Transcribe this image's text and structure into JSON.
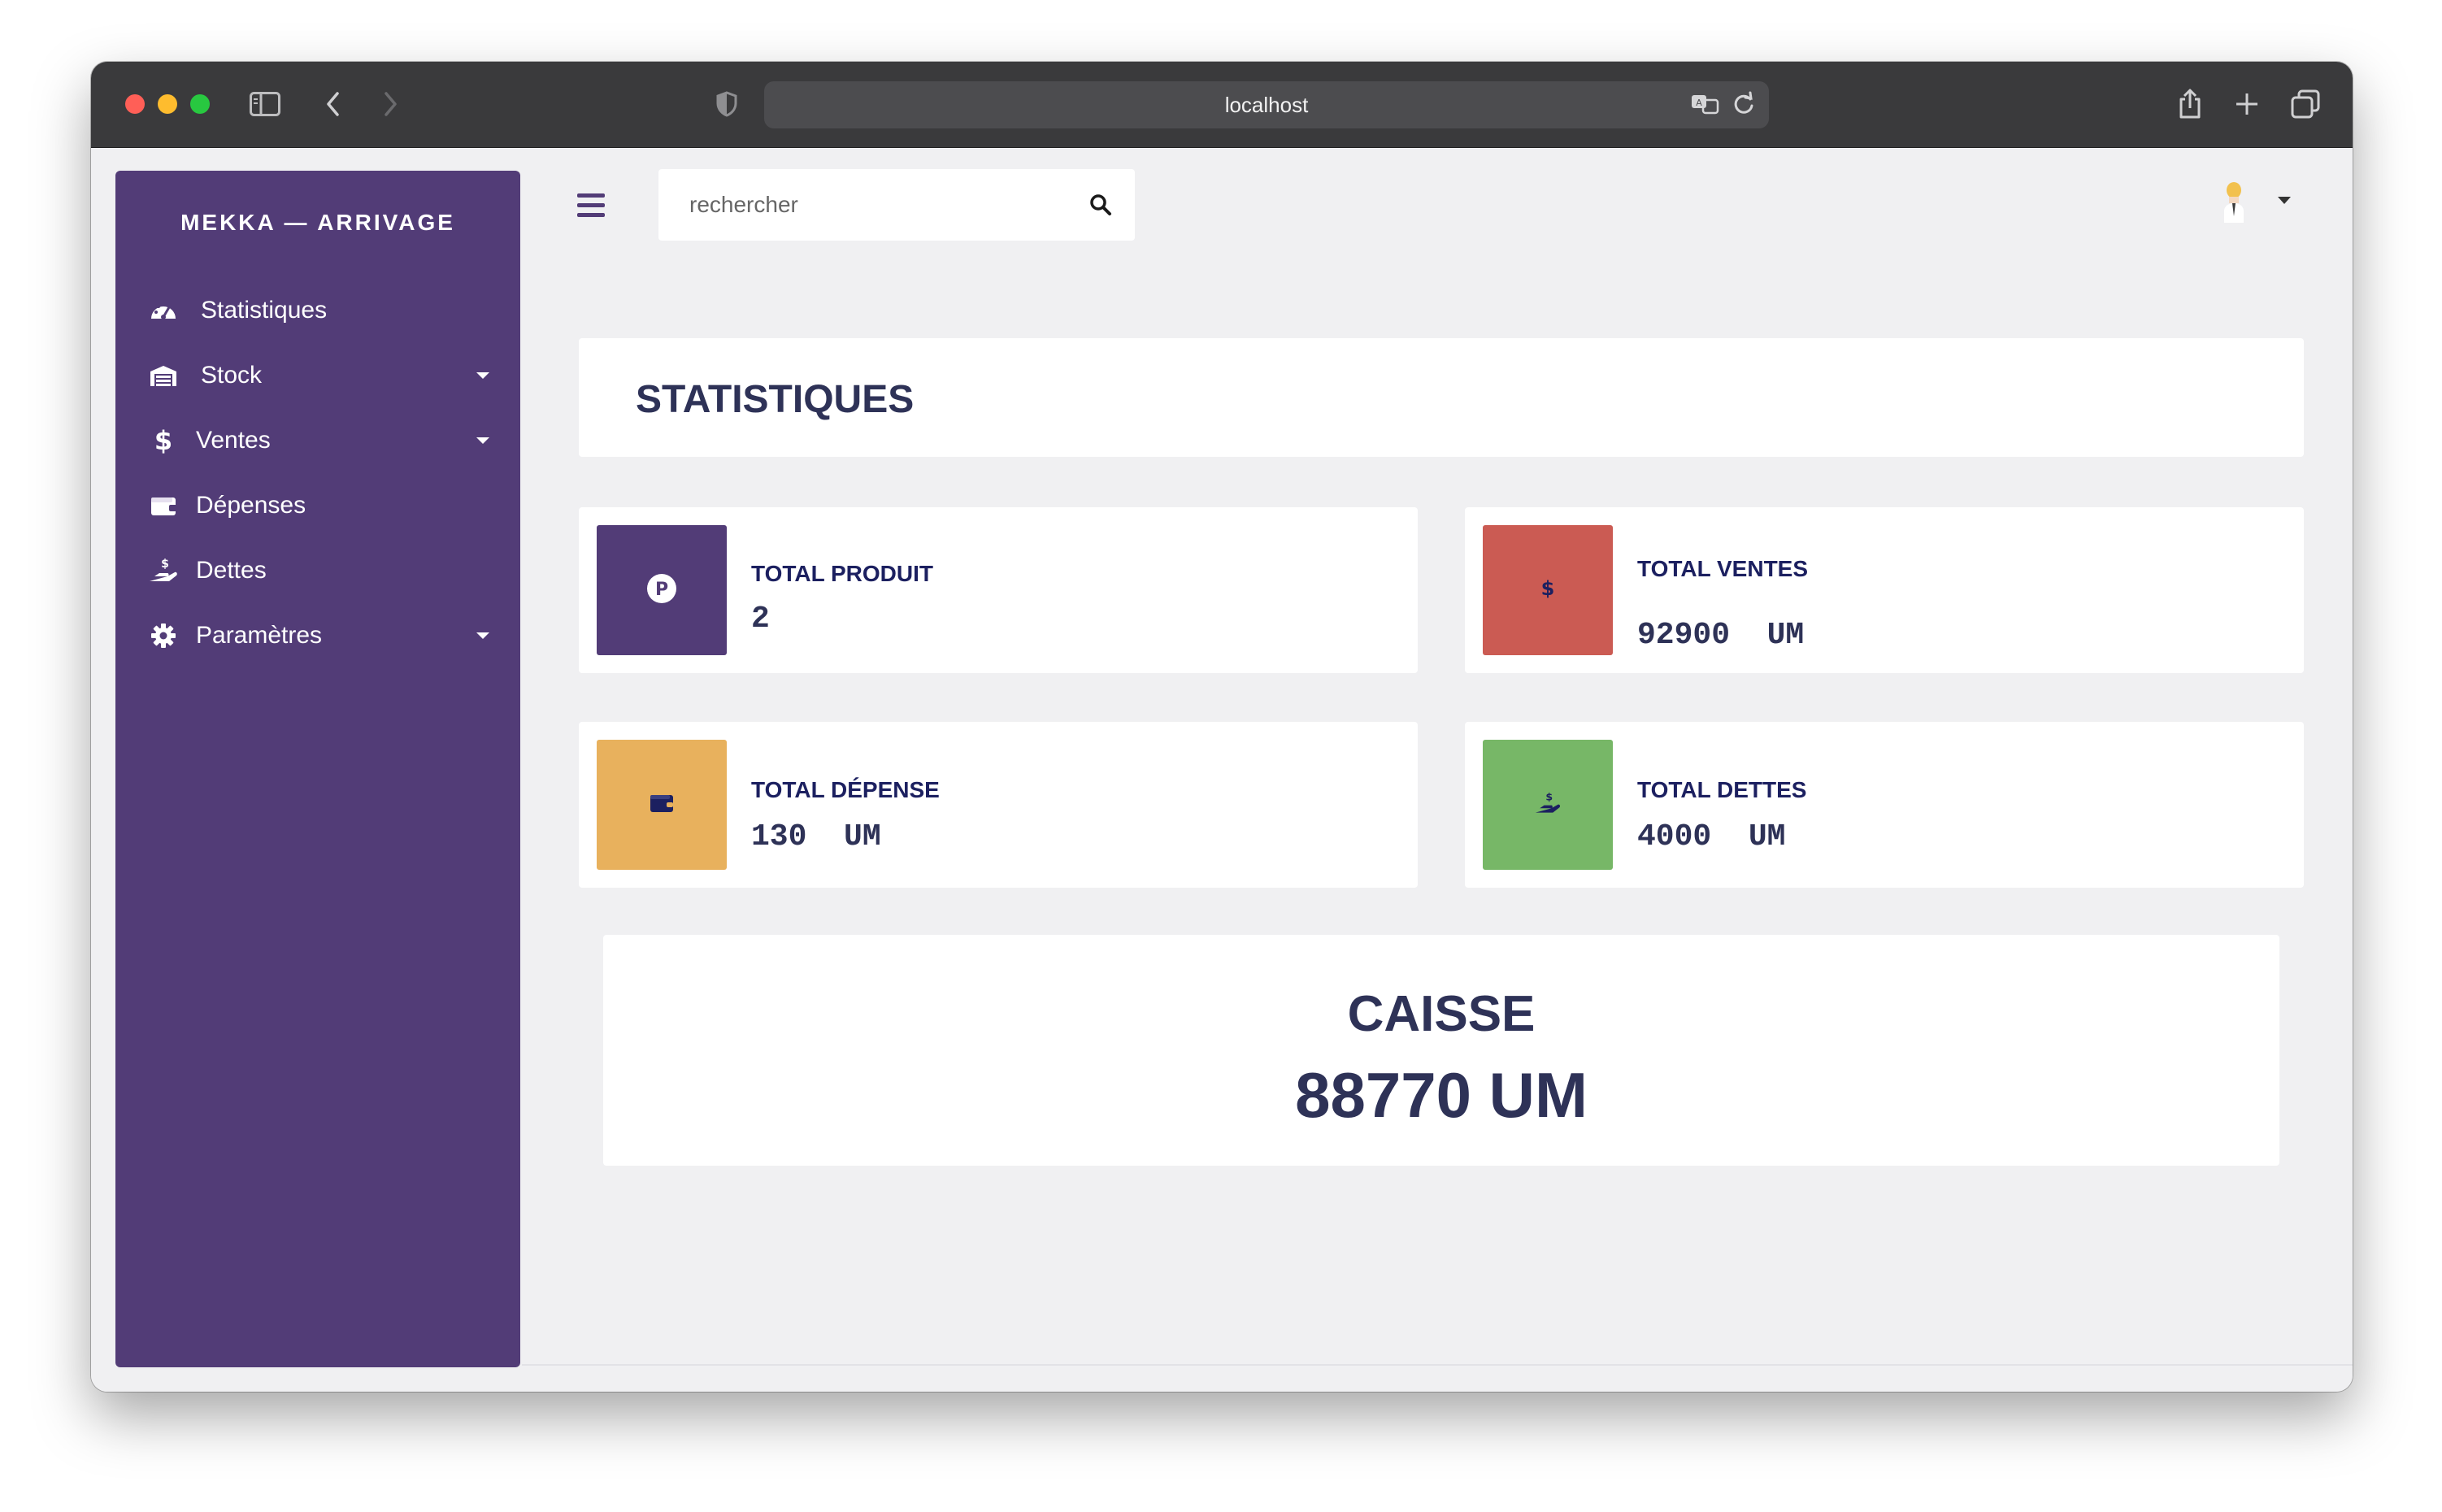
{
  "browser": {
    "url": "localhost",
    "icons": [
      "sidebar-toggle-icon",
      "back-icon",
      "forward-icon",
      "shield-icon",
      "translate-icon",
      "reload-icon",
      "share-icon",
      "new-tab-icon",
      "tabs-icon"
    ]
  },
  "sidebar": {
    "brand": "MEKKA — ARRIVAGE",
    "items": [
      {
        "label": "Statistiques",
        "icon": "dashboard-icon",
        "has_submenu": false
      },
      {
        "label": "Stock",
        "icon": "warehouse-icon",
        "has_submenu": true
      },
      {
        "label": "Ventes",
        "icon": "dollar-icon",
        "has_submenu": true
      },
      {
        "label": "Dépenses",
        "icon": "wallet-icon",
        "has_submenu": false
      },
      {
        "label": "Dettes",
        "icon": "hand-holding-dollar-icon",
        "has_submenu": false
      },
      {
        "label": "Paramètres",
        "icon": "gear-icon",
        "has_submenu": true
      }
    ]
  },
  "topbar": {
    "search_placeholder": "rechercher",
    "user_icon": "user-avatar-icon"
  },
  "main": {
    "page_title": "STATISTIQUES",
    "cards": [
      {
        "label": "TOTAL PRODUIT",
        "value": "2",
        "color": "#523c77",
        "icon": "product-p-icon"
      },
      {
        "label": "TOTAL VENTES",
        "value": "92900  UM",
        "color": "#cb5b53",
        "icon": "dollar-icon"
      },
      {
        "label": "TOTAL DÉPENSE",
        "value": "130  UM",
        "color": "#e8b15d",
        "icon": "wallet-icon"
      },
      {
        "label": "TOTAL DETTES",
        "value": "4000  UM",
        "color": "#77b767",
        "icon": "hand-holding-dollar-icon"
      }
    ],
    "caisse": {
      "title": "CAISSE",
      "value": "88770 UM"
    }
  },
  "colors": {
    "sidebar_bg": "#523c77",
    "page_bg": "#f0f0f2",
    "text_dark": "#2e3257"
  }
}
